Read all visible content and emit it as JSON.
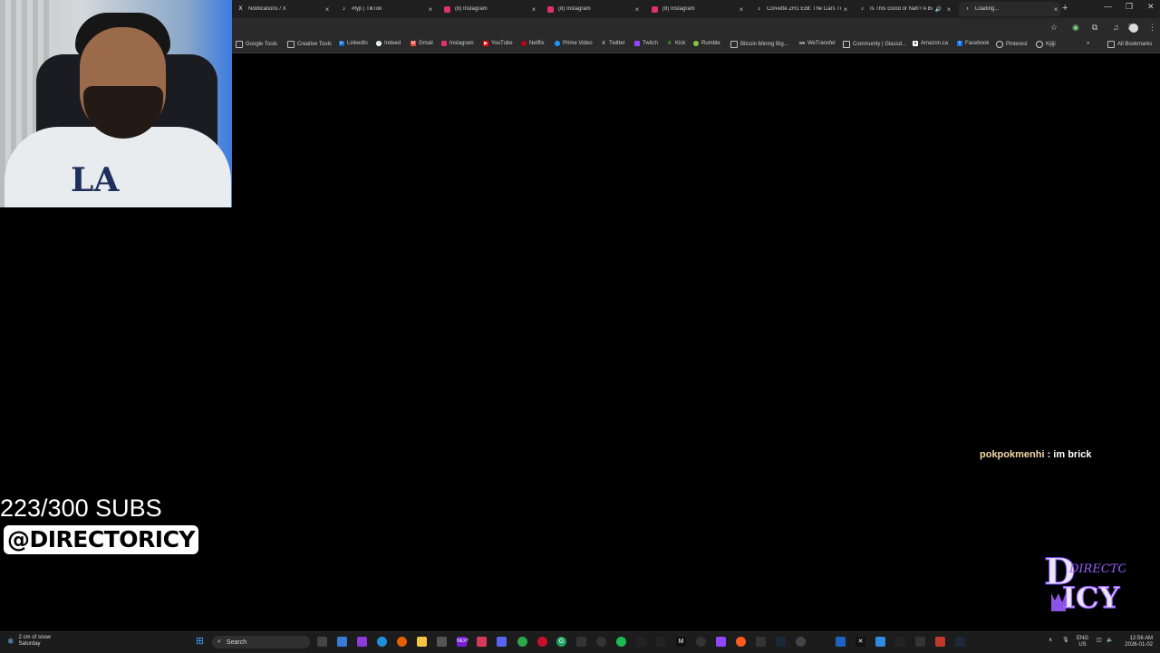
{
  "browser": {
    "tabs": [
      {
        "label": "Notifications / X",
        "icon": "x-icon"
      },
      {
        "label": "#fyp | TikTok",
        "icon": "tiktok-icon"
      },
      {
        "label": "(8) Instagram",
        "icon": "instagram-icon"
      },
      {
        "label": "(8) Instagram",
        "icon": "instagram-icon"
      },
      {
        "label": "(8) Instagram",
        "icon": "instagram-icon"
      },
      {
        "label": "Corvette ZR1 Edit: The Cars Ti",
        "icon": "tiktok-icon"
      },
      {
        "label": "Is This Good or Nah? A Bi",
        "icon": "tiktok-icon"
      },
      {
        "label": "Loading...",
        "icon": "loading-icon"
      }
    ],
    "bookmarks": [
      {
        "label": "Google Tools",
        "icon": "folder-icon"
      },
      {
        "label": "Creative Tools",
        "icon": "folder-icon"
      },
      {
        "label": "LinkedIn",
        "icon": "linkedin-icon"
      },
      {
        "label": "Indeed",
        "icon": "indeed-icon"
      },
      {
        "label": "Gmail",
        "icon": "gmail-icon"
      },
      {
        "label": "Instagram",
        "icon": "instagram-icon"
      },
      {
        "label": "YouTube",
        "icon": "youtube-icon"
      },
      {
        "label": "Netflix",
        "icon": "netflix-icon"
      },
      {
        "label": "Prime Video",
        "icon": "prime-icon"
      },
      {
        "label": "Twitter",
        "icon": "x-icon"
      },
      {
        "label": "Twitch",
        "icon": "twitch-icon"
      },
      {
        "label": "Kick",
        "icon": "kick-icon"
      },
      {
        "label": "Rumble",
        "icon": "rumble-icon"
      },
      {
        "label": "Bitcoin Mining Big...",
        "icon": "folder-icon"
      },
      {
        "label": "WeTransfer",
        "icon": "wetransfer-icon"
      },
      {
        "label": "Community | Glassd...",
        "icon": "glassdoor-icon"
      },
      {
        "label": "Amazon.ca",
        "icon": "amazon-icon"
      },
      {
        "label": "Facebook",
        "icon": "facebook-icon"
      },
      {
        "label": "Pinterest",
        "icon": "pinterest-icon"
      },
      {
        "label": "Kijiji",
        "icon": "kijiji-icon"
      }
    ],
    "all_bookmarks": "All Bookmarks"
  },
  "overlay": {
    "subs": "223/300 SUBS",
    "handle": "@DIRECTORICY",
    "chat_user": "pokpokmenhi",
    "chat_sep": " : ",
    "chat_message": "im brick",
    "logo_text_top": "DIRECTOR",
    "logo_text_bottom": "ICY"
  },
  "taskbar": {
    "weather_line1": "2 cm of snow",
    "weather_line2": "Saturday",
    "search_label": "Search",
    "lang_line1": "ENG",
    "lang_line2": "US",
    "time": "12:56 AM",
    "date": "2026-01-02"
  },
  "colors": {
    "instagram": "#e1306c",
    "youtube": "#ff0000",
    "accent_purple": "#9b5cff"
  }
}
